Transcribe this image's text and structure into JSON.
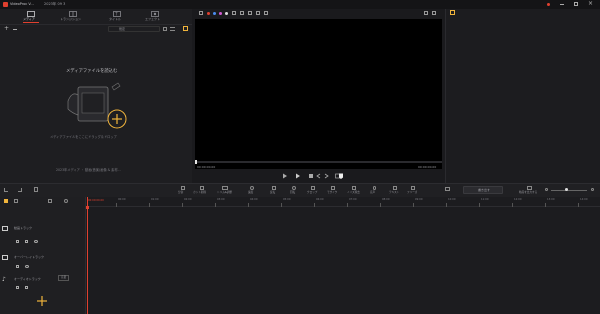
{
  "titlebar": {
    "app_title": "VideoProc V...",
    "project_name": "2023年 09 3",
    "accent": "#e0402f"
  },
  "media_tabs": [
    {
      "label": "メディア",
      "icon": "folder-icon",
      "active": true
    },
    {
      "label": "トランジション",
      "icon": "transition-icon",
      "active": false
    },
    {
      "label": "タイトル",
      "icon": "title-icon",
      "active": false
    },
    {
      "label": "エフェクト",
      "icon": "effect-icon",
      "active": false
    }
  ],
  "media_toolbar": {
    "sort_label": "既定"
  },
  "media_empty": {
    "heading": "メディアファイルを読込む",
    "hint": "メディアファイルをここにドラッグ＆ドロップ",
    "footer": "2023年メディア ・ 動画(音楽)画像 & 素材..."
  },
  "preview": {
    "time_current": "00:00:00.00",
    "time_total": "00:00:00.00"
  },
  "timeline_toolbar": {
    "tools": [
      "分割",
      "カット削除",
      "トリム&調整",
      "速度",
      "反転",
      "回転",
      "クロップ",
      "モザイク",
      "ノイズ除去",
      "音声",
      "テキスト",
      "フリーズ"
    ],
    "export_label": "書き出す",
    "render_label": "動画を出力する"
  },
  "ruler": {
    "start_time": "00:00:00.00",
    "ticks": [
      "00:00",
      "01:00",
      "02:00",
      "03:00",
      "04:00",
      "05:00",
      "06:00",
      "07:00",
      "08:00",
      "09:00",
      "10:00",
      "11:00",
      "12:00",
      "13:00",
      "14:00",
      "15:00"
    ]
  },
  "tracks": [
    {
      "name": "動画トラック",
      "icon": "video-track-icon"
    },
    {
      "name": "オーバーレイトラック",
      "icon": "overlay-track-icon"
    },
    {
      "name": "オーディオトラック",
      "icon": "audio-track-icon",
      "badge": "音量"
    }
  ],
  "colors": {
    "accent": "#e0402f",
    "highlight": "#f0b43c",
    "playhead": "#e0402f"
  }
}
